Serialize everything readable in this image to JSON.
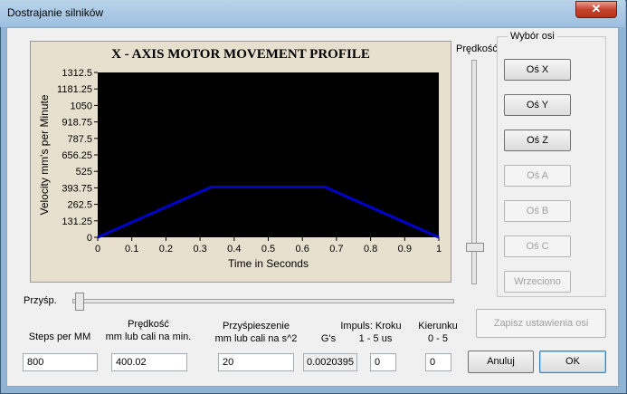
{
  "window": {
    "title": "Dostrajanie silników",
    "close_glyph": "✕"
  },
  "chart_data": {
    "type": "line",
    "title": "X - AXIS MOTOR MOVEMENT PROFILE",
    "xlabel": "Time in Seconds",
    "ylabel": "Velocity mm's per Minute",
    "xlim": [
      0,
      1
    ],
    "ylim": [
      0,
      1312.5
    ],
    "x_ticks": [
      "0",
      "0.1",
      "0.2",
      "0.3",
      "0.4",
      "0.5",
      "0.6",
      "0.7",
      "0.8",
      "0.9",
      "1"
    ],
    "y_ticks": [
      "1312.5",
      "1181.25",
      "1050",
      "918.75",
      "787.5",
      "656.25",
      "525",
      "393.75",
      "262.5",
      "131.25",
      "0"
    ],
    "series": [
      {
        "x": [
          0,
          0.333,
          0.667,
          1
        ],
        "y": [
          0,
          400.02,
          400.02,
          0
        ],
        "color": "#0000cc"
      }
    ],
    "background": "#000000",
    "grid": false
  },
  "speed_slider": {
    "label": "Prędkość",
    "value_fraction": 0.17
  },
  "accel_slider": {
    "label": "Przyśp.",
    "value_fraction": 0.02
  },
  "axis_group": {
    "label": "Wybór osi",
    "buttons": [
      {
        "label": "Oś X",
        "enabled": true
      },
      {
        "label": "Oś Y",
        "enabled": true
      },
      {
        "label": "Oś Z",
        "enabled": true
      },
      {
        "label": "Oś A",
        "enabled": false
      },
      {
        "label": "Oś B",
        "enabled": false
      },
      {
        "label": "Oś C",
        "enabled": false
      },
      {
        "label": "Wrzeciono",
        "enabled": false
      }
    ]
  },
  "save_button": "Zapisz ustawienia osi",
  "fields": {
    "steps": {
      "label": "Steps per MM",
      "value": "800"
    },
    "velocity": {
      "label1": "Prędkość",
      "label2": "mm lub cali na min.",
      "value": "400.02"
    },
    "accel": {
      "label1": "Przyśpieszenie",
      "label2": "mm lub cali na s^2",
      "value": "20"
    },
    "gs": {
      "label": "G's",
      "value": "0.0020395"
    },
    "pulse": {
      "label1": "Impuls:  Kroku",
      "label2": "1 - 5 us",
      "value": "0"
    },
    "direction": {
      "label1": "Kierunku",
      "label2": "0 - 5",
      "value": "0"
    }
  },
  "buttons": {
    "cancel": "Anuluj",
    "ok": "OK"
  }
}
